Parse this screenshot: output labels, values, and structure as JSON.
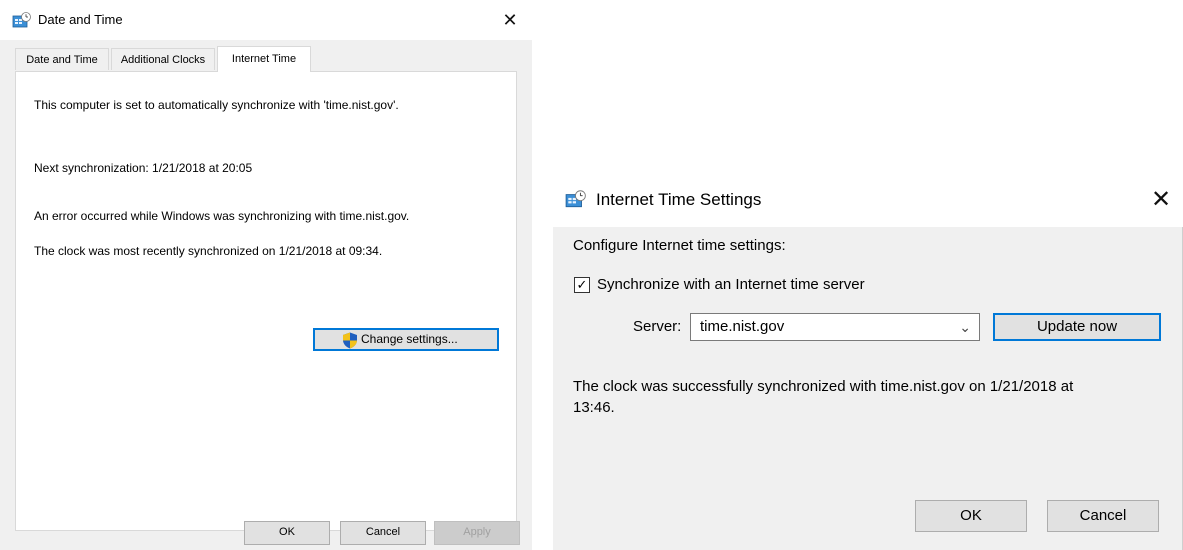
{
  "date_time_dialog": {
    "title": "Date and Time",
    "close_glyph": "✕",
    "tabs": [
      {
        "label": "Date and Time",
        "selected": false
      },
      {
        "label": "Additional Clocks",
        "selected": false
      },
      {
        "label": "Internet Time",
        "selected": true
      }
    ],
    "panel": {
      "sync_server_text": "This computer is set to automatically synchronize with 'time.nist.gov'.",
      "next_sync_text": "Next synchronization: 1/21/2018 at 20:05",
      "error_text": "An error occurred while Windows was synchronizing with time.nist.gov.",
      "last_sync_text": "The clock was most recently synchronized on 1/21/2018 at 09:34.",
      "change_settings_label": "Change settings...",
      "change_settings_icon": "uac-shield-icon"
    },
    "buttons": {
      "ok": "OK",
      "cancel": "Cancel",
      "apply": "Apply"
    }
  },
  "internet_time_dialog": {
    "title": "Internet Time Settings",
    "close_glyph": "✕",
    "heading": "Configure Internet time settings:",
    "sync_checkbox_label": "Synchronize with an Internet time server",
    "sync_checked": true,
    "server_label": "Server:",
    "server_value": "time.nist.gov",
    "update_now_label": "Update now",
    "status_line1": "The clock was successfully synchronized with time.nist.gov on 1/21/2018 at",
    "status_line2": "13:46.",
    "buttons": {
      "ok": "OK",
      "cancel": "Cancel"
    }
  },
  "colors": {
    "accent": "#0078d7",
    "dialog_bg": "#f0f0f0",
    "button_bg": "#e1e1e1"
  }
}
